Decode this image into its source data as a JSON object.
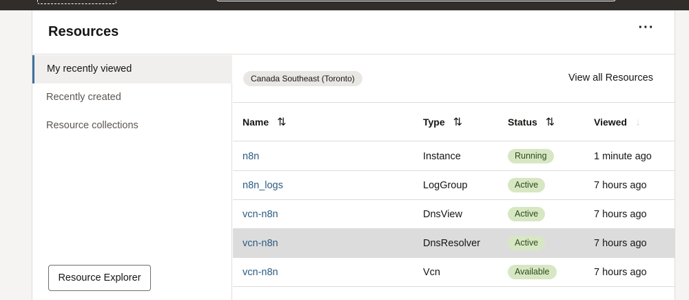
{
  "card": {
    "title": "Resources",
    "more_label": "···"
  },
  "sidebar": {
    "items": [
      {
        "label": "My recently viewed"
      },
      {
        "label": "Recently created"
      },
      {
        "label": "Resource collections"
      }
    ],
    "explorer_button": "Resource Explorer"
  },
  "toolbar": {
    "region": "Canada Southeast (Toronto)",
    "view_all": "View all Resources"
  },
  "table": {
    "headers": {
      "name": "Name",
      "type": "Type",
      "status": "Status",
      "viewed": "Viewed"
    },
    "rows": [
      {
        "name": "n8n",
        "type": "Instance",
        "status": "Running",
        "viewed": "1 minute ago"
      },
      {
        "name": "n8n_logs",
        "type": "LogGroup",
        "status": "Active",
        "viewed": "7 hours ago"
      },
      {
        "name": "vcn-n8n",
        "type": "DnsView",
        "status": "Active",
        "viewed": "7 hours ago"
      },
      {
        "name": "vcn-n8n",
        "type": "DnsResolver",
        "status": "Active",
        "viewed": "7 hours ago"
      },
      {
        "name": "vcn-n8n",
        "type": "Vcn",
        "status": "Available",
        "viewed": "7 hours ago"
      }
    ]
  },
  "icons": {
    "sort": "sort-arrows-icon",
    "sort_desc": "arrow-down-icon",
    "more": "more-horizontal-icon"
  },
  "colors": {
    "accent": "#3f6f9e",
    "link": "#2b5b82",
    "badge_bg": "#d7e7c4",
    "topbar": "#312d2a"
  }
}
